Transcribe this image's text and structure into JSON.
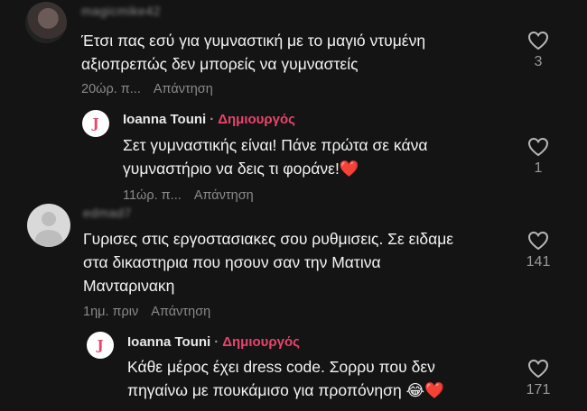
{
  "comments": [
    {
      "username": "magicmike42",
      "text": "Έτσι πας εσύ για γυμναστική με το μαγιό ντυμένη\nαξιοπρεπώς δεν μπορείς να γυμναστείς",
      "time": "20ώρ. π...",
      "reply_label": "Απάντηση",
      "likes": "3",
      "reply": {
        "author": "Ioanna Touni",
        "separator": "·",
        "badge": "Δημιουργός",
        "avatar_letter": "J",
        "text": "Σετ γυμναστικής είναι! Πάνε πρώτα σε κάνα\nγυμναστήριο να δεις τι φοράνε!",
        "emoji": "❤️",
        "time": "11ώρ. π...",
        "reply_label": "Απάντηση",
        "likes": "1"
      }
    },
    {
      "username": "edmad7",
      "text": "Γυρισες στις εργοστασιακες σου ρυθμισεις. Σε ειδαμε\nστα δικαστηρια που ησουν σαν την Ματινα\nΜανταρινακη",
      "time": "1ημ. πριν",
      "reply_label": "Απάντηση",
      "likes": "141",
      "reply": {
        "author": "Ioanna Touni",
        "separator": "·",
        "badge": "Δημιουργός",
        "avatar_letter": "J",
        "text": "Κάθε μέρος έχει dress code. Σορρυ που δεν\nπηγαίνω με πουκάμισο για προπόνηση ",
        "emoji_laugh": "😂",
        "emoji": "❤️",
        "likes": "171"
      }
    }
  ],
  "icons": {
    "like": "heart-outline-icon"
  },
  "colors": {
    "background": "#141414",
    "creator_badge": "#e9446a",
    "muted": "#8a8a8a"
  }
}
